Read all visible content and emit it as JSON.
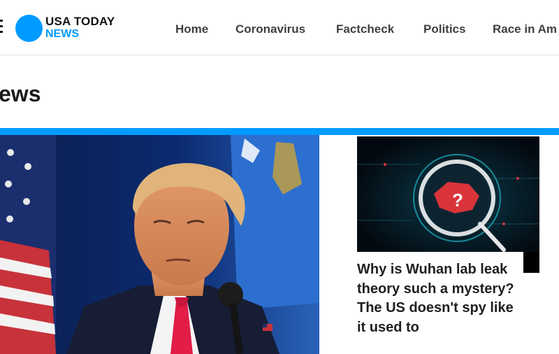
{
  "brand": {
    "name_line1": "USA TODAY",
    "name_line2": "NEWS",
    "accent_color": "#009bff"
  },
  "header": {
    "menu_icon": "hamburger-menu-icon",
    "nav": [
      {
        "label": "Home"
      },
      {
        "label": "Coronavirus"
      },
      {
        "label": "Factcheck"
      },
      {
        "label": "Politics"
      },
      {
        "label": "Race in Am"
      }
    ]
  },
  "section": {
    "title": "ews"
  },
  "stories": {
    "secondary_headline": "Why is Wuhan lab leak theory such a mystery? The US doesn't spy like it used to"
  }
}
